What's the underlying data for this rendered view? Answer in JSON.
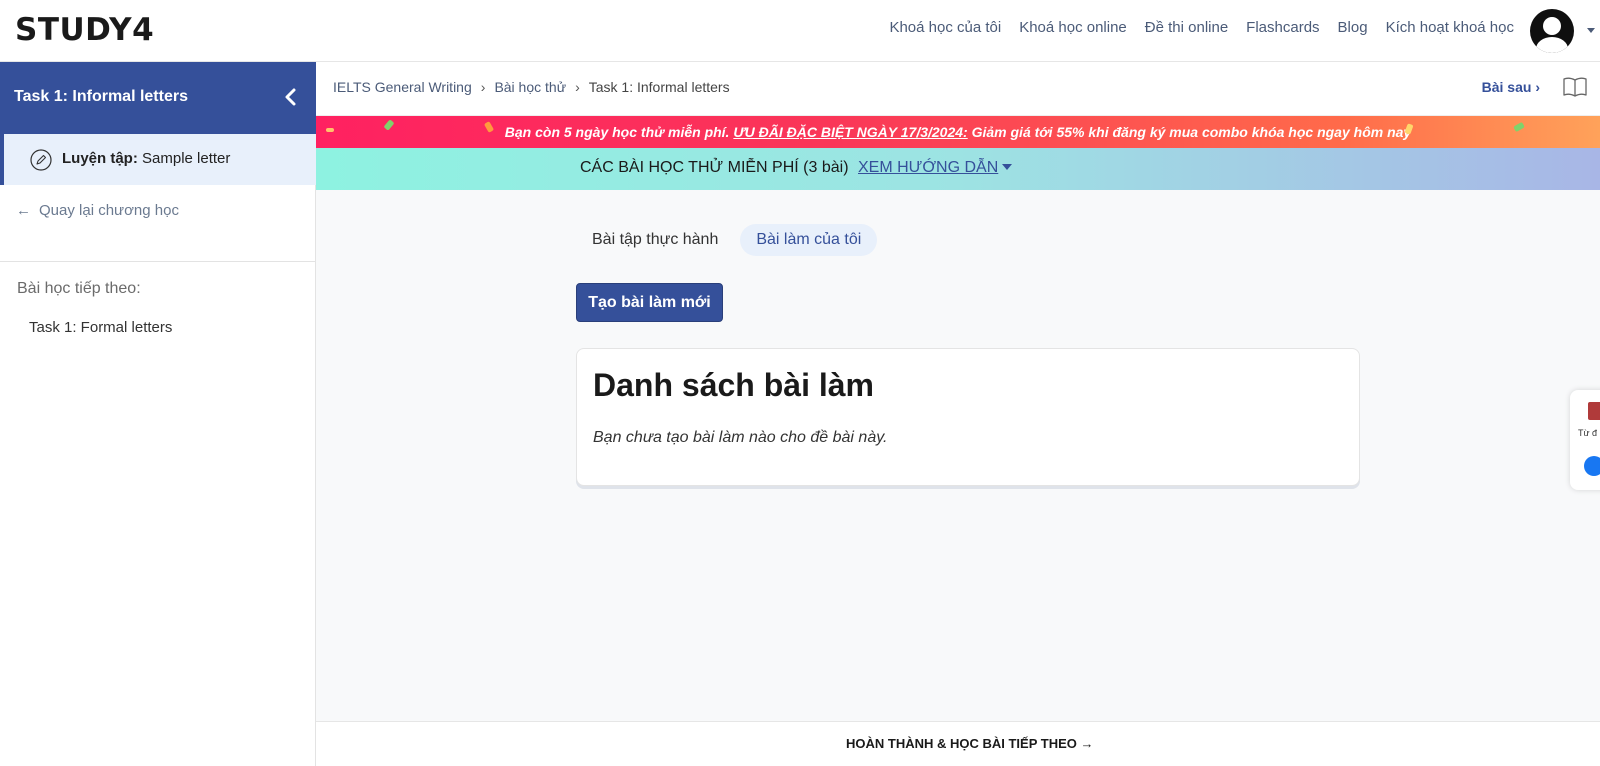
{
  "brand": {
    "logo": "STUDY4"
  },
  "nav": {
    "links": [
      "Khoá học của tôi",
      "Khoá học online",
      "Đề thi online",
      "Flashcards",
      "Blog",
      "Kích hoạt khoá học"
    ]
  },
  "sidebar": {
    "title": "Task 1: Informal letters",
    "active_item": {
      "prefix": "Luyện tập:",
      "label": "Sample letter"
    },
    "back_label": "Quay lại chương học",
    "next_label": "Bài học tiếp theo:",
    "next_item": "Task 1: Formal letters"
  },
  "breadcrumb": {
    "items": [
      "IELTS General Writing",
      "Bài học thử",
      "Task 1: Informal letters"
    ],
    "next_lesson": "Bài sau"
  },
  "promo": {
    "text_before": "Bạn còn 5 ngày học thử miễn phí.",
    "highlight": "ƯU ĐÃI ĐẶC BIỆT NGÀY 17/3/2024:",
    "text_after": "Giảm giá tới 55% khi đăng ký mua combo khóa học ngay hôm nay"
  },
  "trial": {
    "text": "CÁC BÀI HỌC THỬ MIỄN PHÍ (3 bài)",
    "guide": "XEM HƯỚNG DẪN"
  },
  "tabs": [
    "Bài tập thực hành",
    "Bài làm của tôi"
  ],
  "new_button": "Tạo bài làm mới",
  "card": {
    "title": "Danh sách bài làm",
    "empty_text": "Bạn chưa tạo bài làm nào cho đề bài này."
  },
  "footer": {
    "done_label": "HOÀN THÀNH & HỌC BÀI TIẾP THEO"
  },
  "widget": {
    "dict_label": "Từ đ"
  },
  "colors": {
    "primary": "#35509a",
    "promo_start": "#ff2161",
    "promo_end": "#ffa25a"
  }
}
